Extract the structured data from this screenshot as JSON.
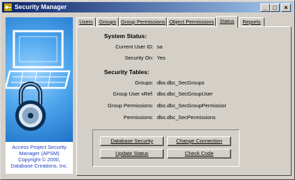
{
  "window": {
    "title": "Security Manager",
    "controls": {
      "minimize": "_",
      "maximize": "□",
      "close": "×"
    }
  },
  "art": {
    "icon": "padlock-over-keyboard-icon",
    "credits": [
      "Access Project Security",
      "Manager (APSM)",
      "Copyright © 2000,",
      "Database Creations, Inc."
    ]
  },
  "tabs": [
    {
      "label": "Users"
    },
    {
      "label": "Groups"
    },
    {
      "label": "Group Permissions"
    },
    {
      "label": "Object Permissions"
    },
    {
      "label": "Status",
      "active": true
    },
    {
      "label": "Reports"
    }
  ],
  "status": {
    "system_title": "System Status:",
    "current_user_label": "Current User ID:",
    "current_user_value": "sa",
    "security_on_label": "Security On:",
    "security_on_value": "Yes",
    "tables_title": "Security Tables:",
    "groups_label": "Groups:",
    "groups_value": "dbo.dbc_SecGroups",
    "group_user_label": "Group User xRef:",
    "group_user_value": "dbo.dbc_SecGroupUser",
    "group_perm_label": "Group Permissions:",
    "group_perm_value": "dbo.dbc_SecGroupPermissior",
    "perm_label": "Permissions:",
    "perm_value": "dbo.dbc_SecPermissions"
  },
  "buttons": {
    "database_security": "Database Security",
    "change_connection": "Change Connection",
    "update_status": "Update Status",
    "check_code": "Check Code"
  }
}
